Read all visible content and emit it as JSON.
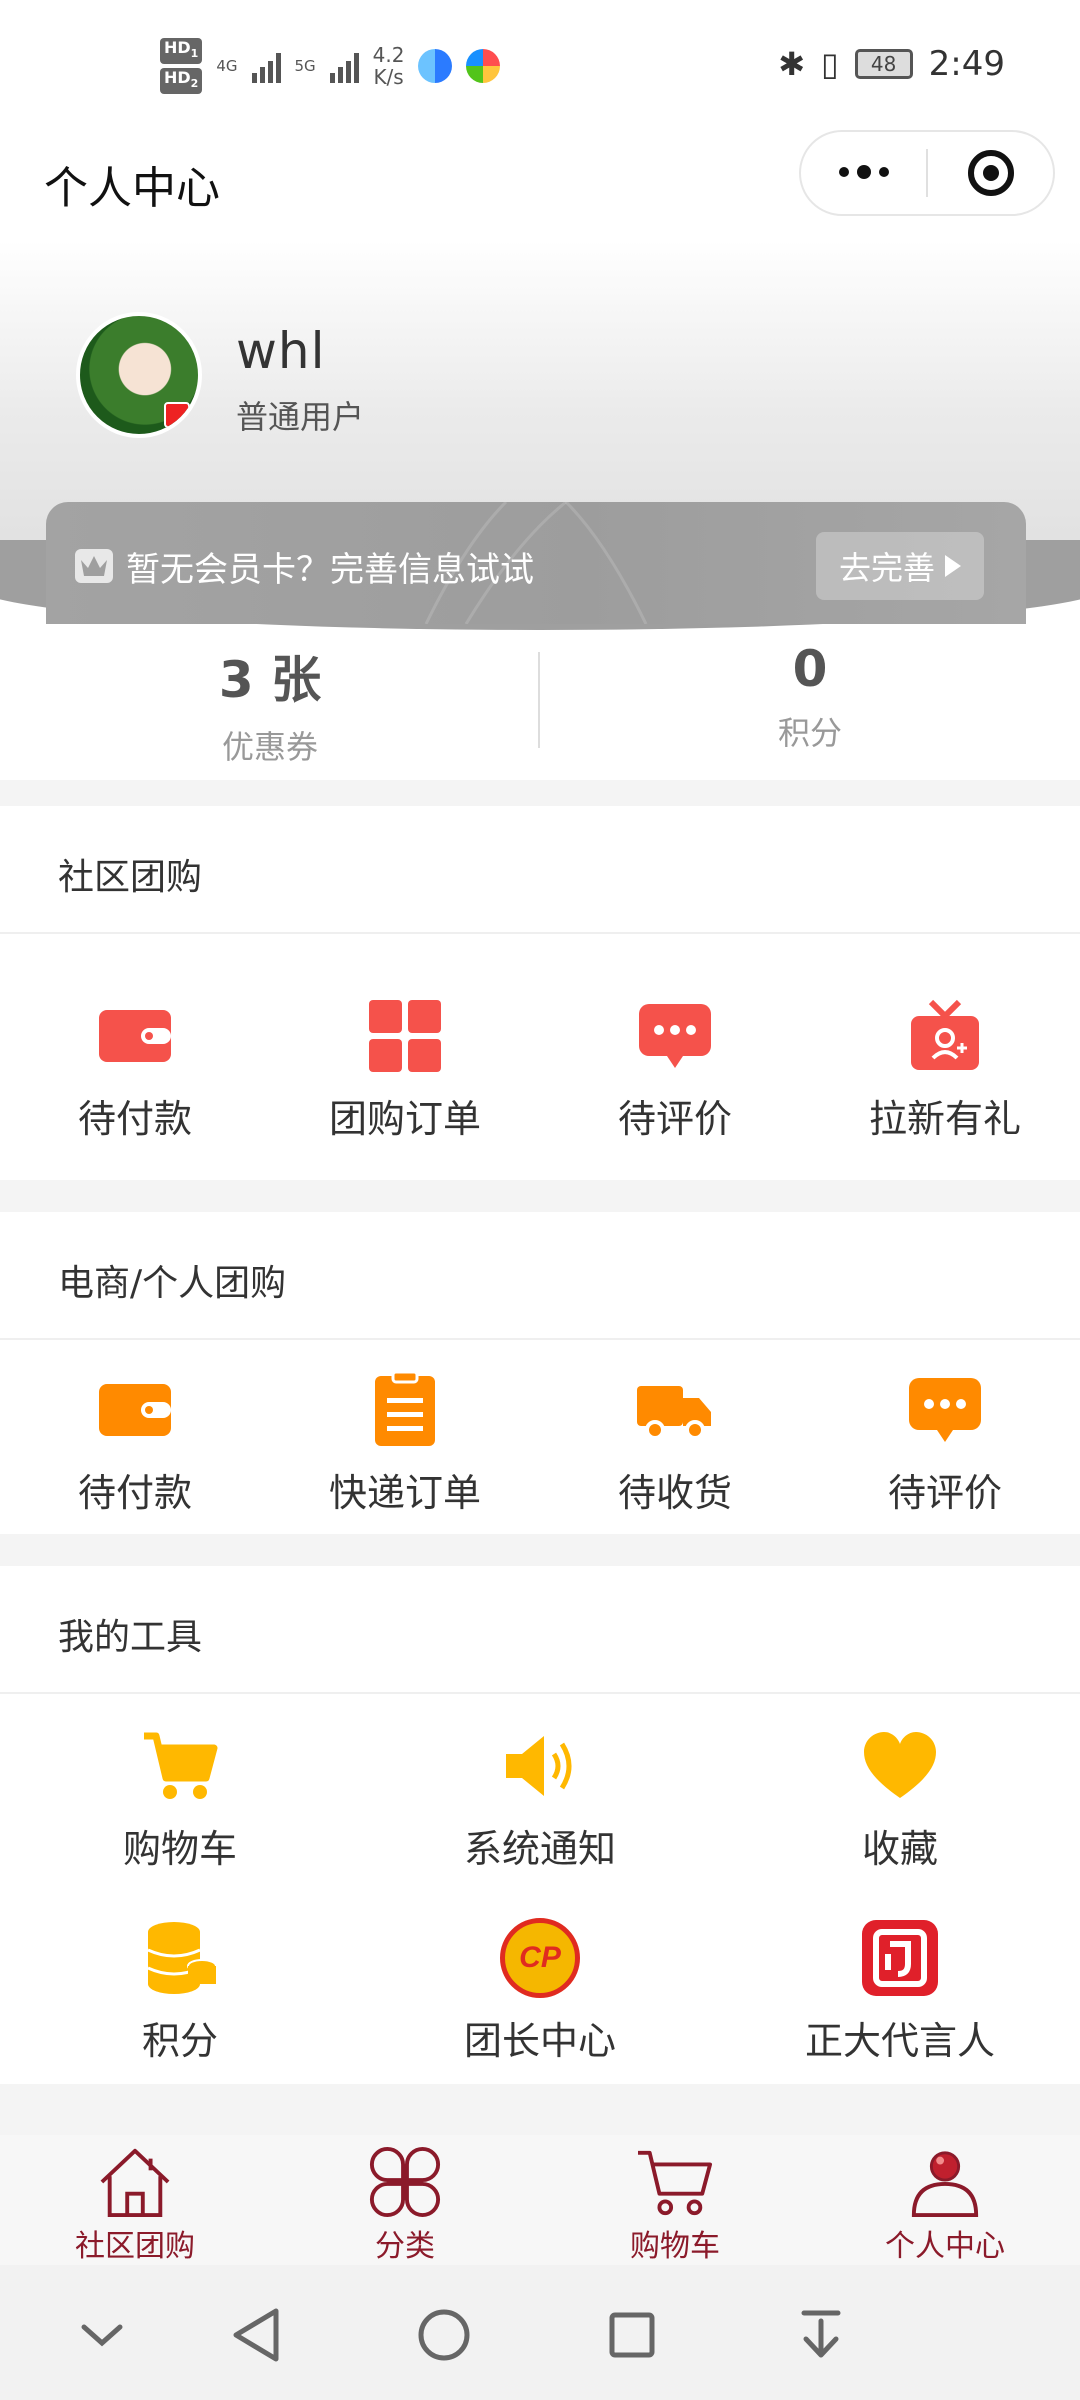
{
  "status_bar": {
    "hd1": "HD",
    "hd1_sub": "1",
    "hd2": "HD",
    "hd2_sub": "2",
    "net1": "4G",
    "net2": "5G",
    "speed_value": "4.2",
    "speed_unit": "K/s",
    "battery": "48",
    "time": "2:49"
  },
  "header": {
    "title": "个人中心",
    "more_icon": "more-dots-icon",
    "close_icon": "target-icon"
  },
  "profile": {
    "name": "whl",
    "level": "普通用户",
    "vip_text": "暂无会员卡？完善信息试试",
    "vip_button": "去完善"
  },
  "stats": [
    {
      "value": "3 张",
      "label": "优惠券"
    },
    {
      "value": "0",
      "label": "积分"
    }
  ],
  "community": {
    "title": "社区团购",
    "items": [
      {
        "label": "待付款",
        "icon": "wallet-icon"
      },
      {
        "label": "团购订单",
        "icon": "grid-icon"
      },
      {
        "label": "待评价",
        "icon": "chat-bubble-icon"
      },
      {
        "label": "拉新有礼",
        "icon": "gift-icon"
      }
    ]
  },
  "ecommerce": {
    "title": "电商/个人团购",
    "items": [
      {
        "label": "待付款",
        "icon": "wallet-icon"
      },
      {
        "label": "快递订单",
        "icon": "clipboard-icon"
      },
      {
        "label": "待收货",
        "icon": "truck-icon"
      },
      {
        "label": "待评价",
        "icon": "chat-bubble-icon"
      }
    ]
  },
  "tools": {
    "title": "我的工具",
    "items": [
      {
        "label": "购物车",
        "icon": "cart-icon"
      },
      {
        "label": "系统通知",
        "icon": "speaker-icon"
      },
      {
        "label": "收藏",
        "icon": "heart-icon"
      },
      {
        "label": "积分",
        "icon": "coins-icon"
      },
      {
        "label": "团长中心",
        "icon": "cp-badge-icon",
        "badge_text": "CP"
      },
      {
        "label": "正大代言人",
        "icon": "brand-logo-icon"
      }
    ]
  },
  "bottom_nav": [
    {
      "label": "社区团购",
      "icon": "home-icon"
    },
    {
      "label": "分类",
      "icon": "category-icon"
    },
    {
      "label": "购物车",
      "icon": "cart-icon"
    },
    {
      "label": "个人中心",
      "icon": "user-icon"
    }
  ],
  "colors": {
    "accent_red": "#f5524b",
    "accent_orange": "#ff8a00",
    "accent_yellow": "#ffb800",
    "nav_dark_red": "#8b1a2a"
  }
}
